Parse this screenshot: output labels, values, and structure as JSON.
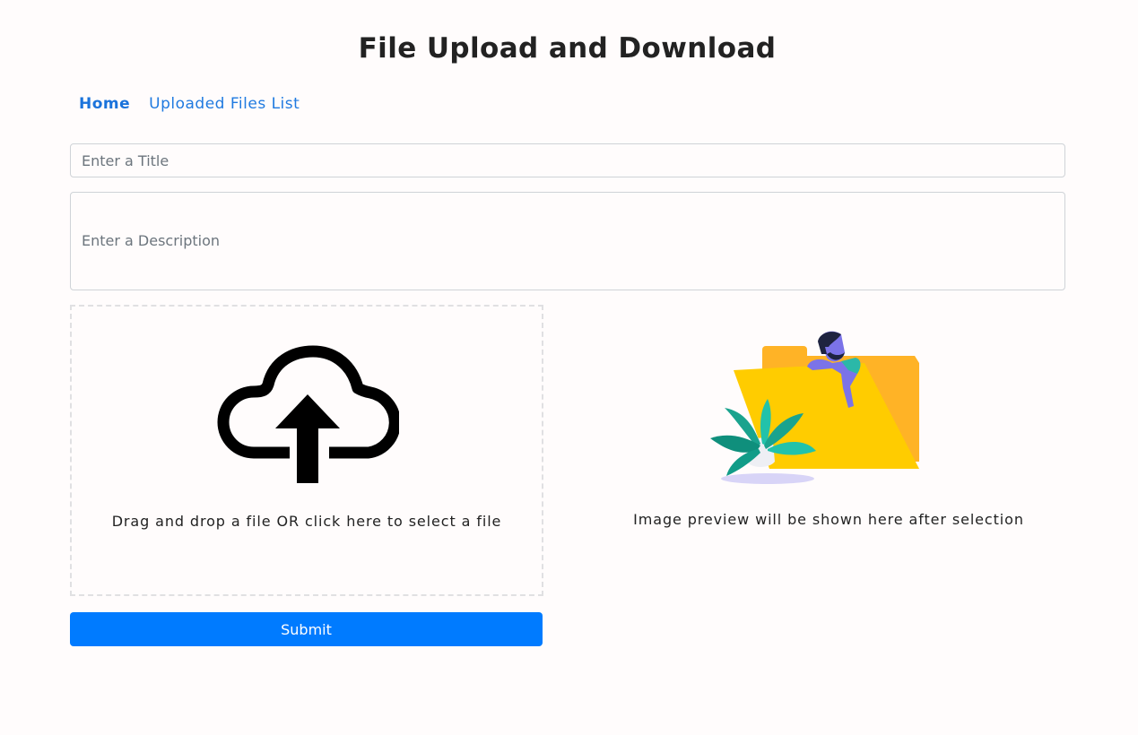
{
  "header": {
    "title": "File Upload and Download"
  },
  "nav": {
    "home_label": "Home",
    "files_label": "Uploaded Files List"
  },
  "form": {
    "title_placeholder": "Enter a Title",
    "title_value": "",
    "description_placeholder": "Enter a Description",
    "description_value": "",
    "dropzone_text": "Drag and drop a file OR click here to select a file",
    "preview_text": "Image preview will be shown here after selection",
    "submit_label": "Submit"
  },
  "icons": {
    "upload": "cloud-upload-icon",
    "preview": "folder-with-person-illustration"
  },
  "colors": {
    "accent": "#007bff",
    "link": "#1f7ae0",
    "folder": "#ffcc00"
  }
}
